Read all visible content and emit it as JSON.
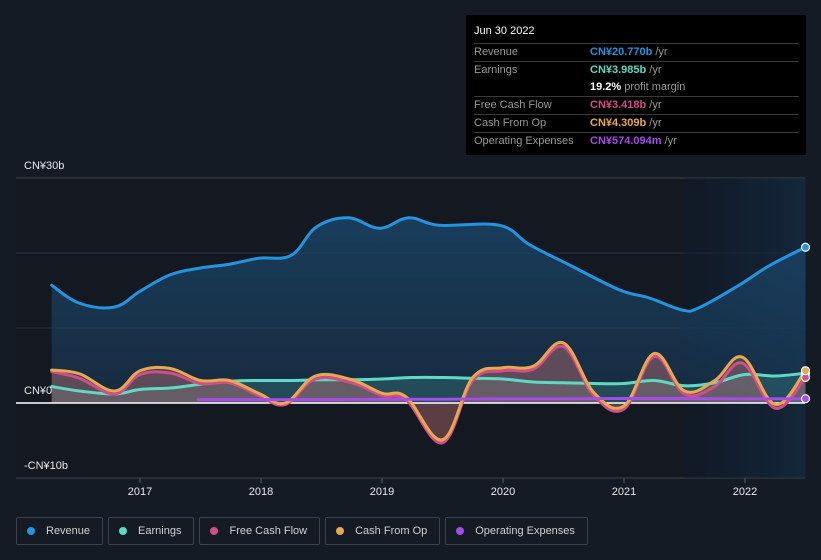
{
  "chart_data": {
    "type": "area",
    "title": "",
    "xlabel": "",
    "ylabel": "",
    "ylim": [
      -10,
      30
    ],
    "xlim": [
      2016.27,
      2022.5
    ],
    "y_ticks": [
      {
        "value": 30,
        "label": "CN¥30b"
      },
      {
        "value": 0,
        "label": "CN¥0"
      },
      {
        "value": -10,
        "label": "-CN¥10b"
      }
    ],
    "x_ticks": [
      {
        "value": 2017,
        "label": "2017"
      },
      {
        "value": 2018,
        "label": "2018"
      },
      {
        "value": 2019,
        "label": "2019"
      },
      {
        "value": 2020,
        "label": "2020"
      },
      {
        "value": 2021,
        "label": "2021"
      },
      {
        "value": 2022,
        "label": "2022"
      }
    ],
    "grid": true,
    "legend_position": "bottom-left",
    "highlight_range": [
      2021.5,
      2022.5
    ],
    "units": "CN¥ billions",
    "series": [
      {
        "name": "Revenue",
        "color": "#2394df",
        "x": [
          2016.27,
          2016.5,
          2016.79,
          2017.0,
          2017.25,
          2017.5,
          2017.74,
          2017.98,
          2018.25,
          2018.46,
          2018.72,
          2018.98,
          2019.22,
          2019.47,
          2019.97,
          2020.22,
          2020.55,
          2020.96,
          2021.21,
          2021.48,
          2021.62,
          2021.95,
          2022.2,
          2022.5
        ],
        "values": [
          15.7,
          13.3,
          12.8,
          14.9,
          17.1,
          18.0,
          18.5,
          19.3,
          19.7,
          23.5,
          24.7,
          23.3,
          24.7,
          23.7,
          23.7,
          21.1,
          18.4,
          15.1,
          14.0,
          12.4,
          12.7,
          15.7,
          18.3,
          20.77
        ]
      },
      {
        "name": "Earnings",
        "color": "#5fd9c4",
        "x": [
          2016.27,
          2016.5,
          2016.79,
          2017.0,
          2017.25,
          2017.5,
          2017.74,
          2017.98,
          2018.25,
          2018.5,
          2018.75,
          2019.0,
          2019.25,
          2019.5,
          2019.75,
          2020.0,
          2020.25,
          2020.5,
          2020.75,
          2021.0,
          2021.25,
          2021.5,
          2021.75,
          2022.0,
          2022.25,
          2022.5
        ],
        "values": [
          2.2,
          1.6,
          1.2,
          1.8,
          2.0,
          2.5,
          2.9,
          3.0,
          3.0,
          3.1,
          3.1,
          3.2,
          3.4,
          3.4,
          3.3,
          3.2,
          2.8,
          2.7,
          2.6,
          2.6,
          3.0,
          2.3,
          2.7,
          3.8,
          3.6,
          3.985
        ]
      },
      {
        "name": "Free Cash Flow",
        "color": "#d14f86",
        "x": [
          2016.27,
          2016.5,
          2016.79,
          2017.0,
          2017.25,
          2017.5,
          2017.74,
          2017.98,
          2018.2,
          2018.45,
          2018.75,
          2019.0,
          2019.2,
          2019.5,
          2019.75,
          2020.0,
          2020.25,
          2020.5,
          2020.75,
          2021.0,
          2021.25,
          2021.5,
          2021.75,
          2021.98,
          2022.25,
          2022.5
        ],
        "values": [
          4.2,
          3.3,
          1.2,
          3.8,
          4.0,
          2.6,
          2.7,
          1.0,
          -0.2,
          3.2,
          2.7,
          1.0,
          0.4,
          -5.3,
          3.0,
          4.3,
          4.5,
          7.5,
          1.0,
          -0.8,
          6.2,
          1.2,
          2.2,
          5.3,
          -0.7,
          3.418
        ]
      },
      {
        "name": "Cash From Op",
        "color": "#e8a850",
        "x": [
          2016.27,
          2016.5,
          2016.79,
          2017.0,
          2017.25,
          2017.5,
          2017.74,
          2017.98,
          2018.2,
          2018.45,
          2018.75,
          2019.0,
          2019.2,
          2019.5,
          2019.75,
          2020.0,
          2020.25,
          2020.5,
          2020.75,
          2021.0,
          2021.25,
          2021.5,
          2021.75,
          2021.98,
          2022.25,
          2022.5
        ],
        "values": [
          4.4,
          3.9,
          1.6,
          4.3,
          4.6,
          3.0,
          3.0,
          1.3,
          0.0,
          3.6,
          3.1,
          1.3,
          0.8,
          -4.9,
          3.4,
          4.7,
          4.9,
          8.0,
          1.4,
          -0.4,
          6.6,
          1.6,
          3.0,
          6.1,
          -0.2,
          4.309
        ]
      },
      {
        "name": "Operating Expenses",
        "color": "#a54de8",
        "x": [
          2017.48,
          2018.0,
          2018.5,
          2019.0,
          2019.5,
          2020.0,
          2020.5,
          2021.0,
          2021.5,
          2022.0,
          2022.5
        ],
        "values": [
          0.45,
          0.45,
          0.45,
          0.5,
          0.5,
          0.55,
          0.55,
          0.6,
          0.6,
          0.55,
          0.574
        ]
      }
    ]
  },
  "tooltip": {
    "date": "Jun 30 2022",
    "rows": [
      {
        "label": "Revenue",
        "value": "CN¥20.770b",
        "unit": "/yr",
        "color": "#2394df"
      },
      {
        "label": "Earnings",
        "value": "CN¥3.985b",
        "unit": "/yr",
        "color": "#5fd9c4"
      },
      {
        "label": "",
        "value": "19.2%",
        "unit": "profit margin",
        "color": "#ffffff"
      },
      {
        "label": "Free Cash Flow",
        "value": "CN¥3.418b",
        "unit": "/yr",
        "color": "#d14f86"
      },
      {
        "label": "Cash From Op",
        "value": "CN¥4.309b",
        "unit": "/yr",
        "color": "#e8a850"
      },
      {
        "label": "Operating Expenses",
        "value": "CN¥574.094m",
        "unit": "/yr",
        "color": "#a54de8"
      }
    ]
  },
  "legend": [
    {
      "label": "Revenue",
      "color": "#2394df"
    },
    {
      "label": "Earnings",
      "color": "#5fd9c4"
    },
    {
      "label": "Free Cash Flow",
      "color": "#d14f86"
    },
    {
      "label": "Cash From Op",
      "color": "#e8a850"
    },
    {
      "label": "Operating Expenses",
      "color": "#a54de8"
    }
  ]
}
